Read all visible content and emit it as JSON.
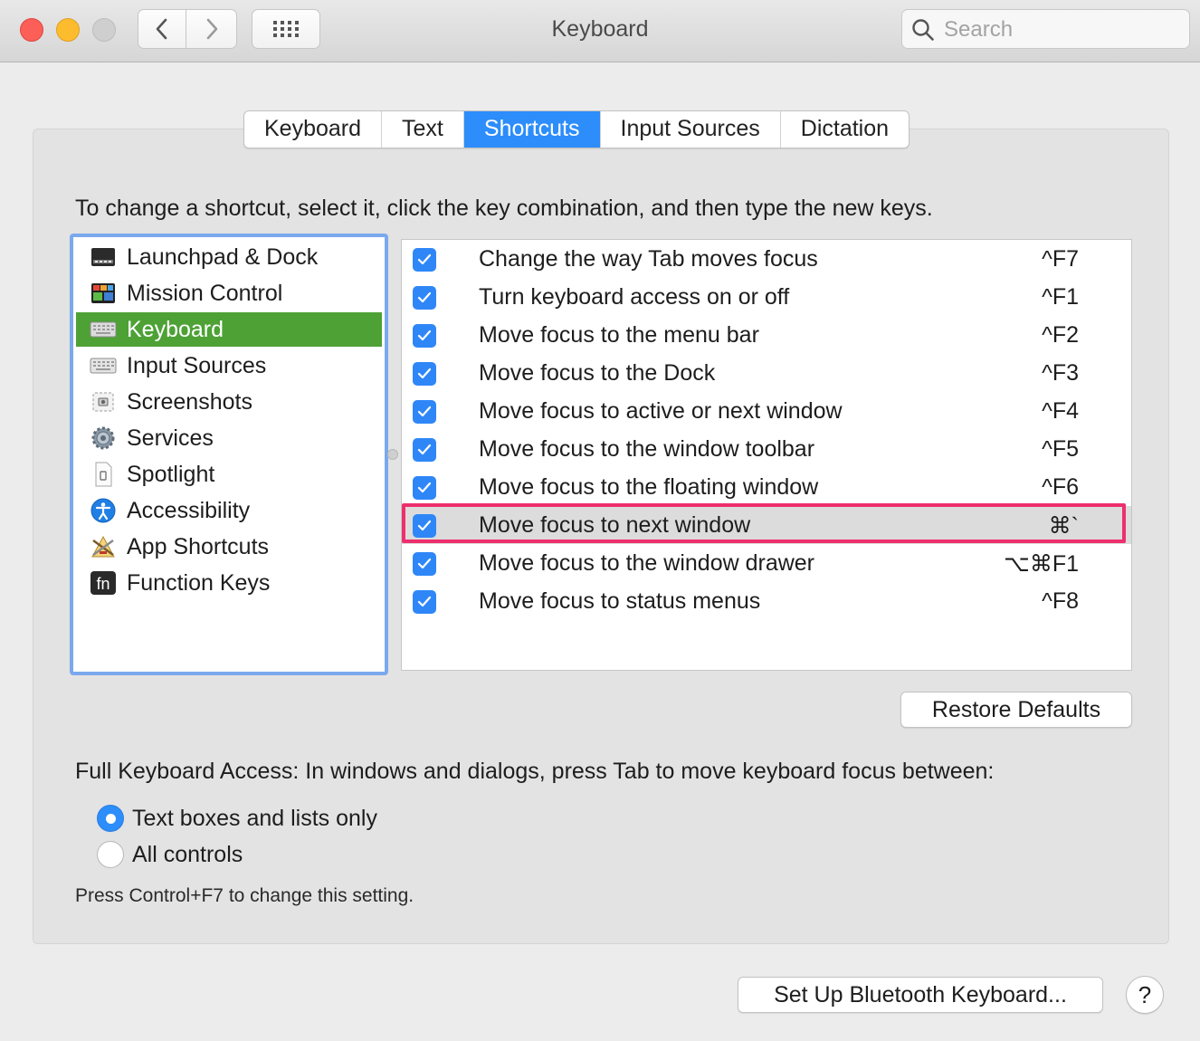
{
  "window": {
    "title": "Keyboard"
  },
  "toolbar": {
    "search_placeholder": "Search"
  },
  "tabs": [
    {
      "label": "Keyboard"
    },
    {
      "label": "Text"
    },
    {
      "label": "Shortcuts",
      "active": true
    },
    {
      "label": "Input Sources"
    },
    {
      "label": "Dictation"
    }
  ],
  "instructions": "To change a shortcut, select it, click the key combination, and then type the new keys.",
  "categories": [
    {
      "label": "Launchpad & Dock",
      "icon": "launchpad-dock-icon"
    },
    {
      "label": "Mission Control",
      "icon": "mission-control-icon"
    },
    {
      "label": "Keyboard",
      "icon": "keyboard-icon",
      "selected": true
    },
    {
      "label": "Input Sources",
      "icon": "input-sources-icon"
    },
    {
      "label": "Screenshots",
      "icon": "screenshots-icon"
    },
    {
      "label": "Services",
      "icon": "services-gear-icon"
    },
    {
      "label": "Spotlight",
      "icon": "spotlight-icon"
    },
    {
      "label": "Accessibility",
      "icon": "accessibility-icon"
    },
    {
      "label": "App Shortcuts",
      "icon": "app-shortcuts-icon"
    },
    {
      "label": "Function Keys",
      "icon": "function-keys-icon"
    }
  ],
  "shortcuts": [
    {
      "label": "Change the way Tab moves focus",
      "keys": "^F7",
      "checked": true
    },
    {
      "label": "Turn keyboard access on or off",
      "keys": "^F1",
      "checked": true
    },
    {
      "label": "Move focus to the menu bar",
      "keys": "^F2",
      "checked": true
    },
    {
      "label": "Move focus to the Dock",
      "keys": "^F3",
      "checked": true
    },
    {
      "label": "Move focus to active or next window",
      "keys": "^F4",
      "checked": true
    },
    {
      "label": "Move focus to the window toolbar",
      "keys": "^F5",
      "checked": true
    },
    {
      "label": "Move focus to the floating window",
      "keys": "^F6",
      "checked": true
    },
    {
      "label": "Move focus to next window",
      "keys": "⌘`",
      "checked": true,
      "highlighted": true
    },
    {
      "label": "Move focus to the window drawer",
      "keys": "⌥⌘F1",
      "checked": true
    },
    {
      "label": "Move focus to status menus",
      "keys": "^F8",
      "checked": true
    }
  ],
  "restore_defaults_label": "Restore Defaults",
  "full_keyboard_access": {
    "label": "Full Keyboard Access: In windows and dialogs, press Tab to move keyboard focus between:",
    "options": [
      {
        "label": "Text boxes and lists only",
        "selected": true
      },
      {
        "label": "All controls",
        "selected": false
      }
    ],
    "hint": "Press Control+F7 to change this setting."
  },
  "bluetooth_button_label": "Set Up Bluetooth Keyboard...",
  "help_label": "?",
  "colors": {
    "accent_blue": "#2c8dfb",
    "selection_green": "#4da135",
    "highlight_pink": "#ee2f6d"
  }
}
